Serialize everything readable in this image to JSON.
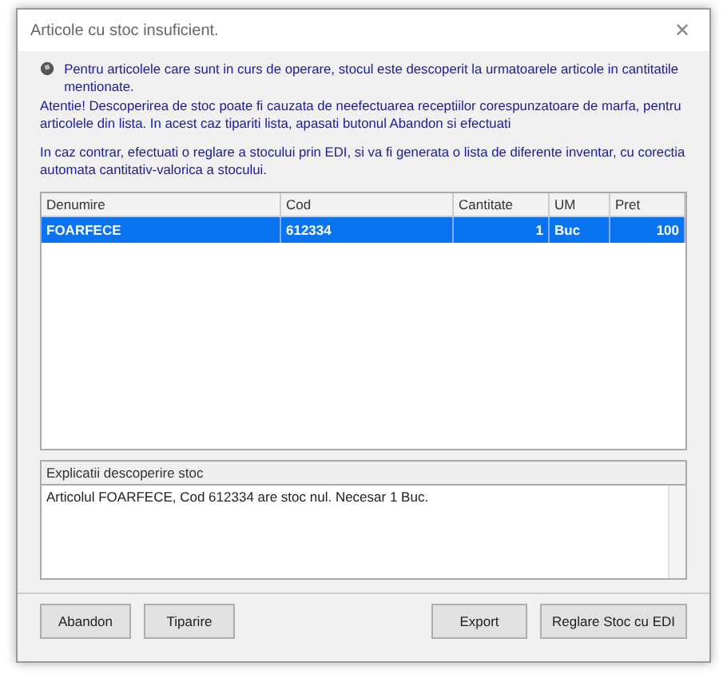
{
  "window": {
    "title": "Articole cu stoc insuficient.",
    "close": "✕"
  },
  "message": {
    "paragraphs": [
      "Pentru articolele care sunt in curs de operare, stocul este descoperit la urmatoarele articole in cantitatile mentionate.",
      "Atentie! Descoperirea de stoc poate fi cauzata de neefectuarea receptiilor corespunzatoare de marfa, pentru articolele din lista. In acest caz tipariti lista, apasati butonul Abandon si efectuati",
      "In caz contrar, efectuati o reglare a stocului prin EDI, si va fi generata o lista de diferente inventar, cu corectia automata cantitativ-valorica a stocului."
    ]
  },
  "table": {
    "columns": [
      {
        "label": "Denumire",
        "kind": "text"
      },
      {
        "label": "Cod",
        "kind": "text"
      },
      {
        "label": "Cantitate",
        "kind": "number"
      },
      {
        "label": "UM",
        "kind": "text"
      },
      {
        "label": "Pret",
        "kind": "number"
      }
    ],
    "rows": [
      {
        "selected": true,
        "cells": [
          "FOARFECE",
          "612334",
          "1",
          "Buc",
          "100"
        ]
      }
    ]
  },
  "explanation": {
    "label": "Explicatii descoperire stoc",
    "value": "Articolul FOARFECE, Cod 612334 are stoc nul. Necesar 1 Buc."
  },
  "buttons_left": [
    "Abandon",
    "Tiparire"
  ],
  "buttons_right": [
    "Export",
    "Reglare Stoc cu EDI"
  ]
}
